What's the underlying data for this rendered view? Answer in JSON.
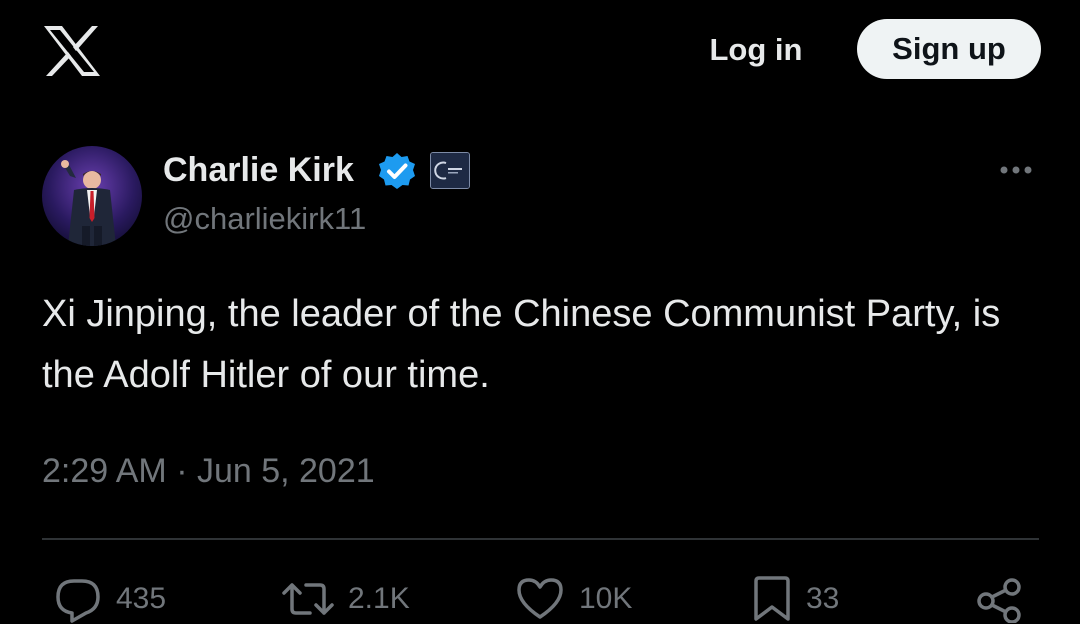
{
  "header": {
    "logo_icon": "x-logo-icon",
    "login_label": "Log in",
    "signup_label": "Sign up"
  },
  "tweet": {
    "author": {
      "name": "Charlie Kirk",
      "handle": "@charliekirk11",
      "verified_icon": "verified-badge-icon",
      "verified_color": "#1d9bf0",
      "affiliate_icon": "affiliate-badge-icon"
    },
    "more_icon": "more-horizontal-icon",
    "text": "Xi Jinping, the leader of the Chinese Communist Party, is the Adolf Hitler of our time.",
    "timestamp": "2:29 AM · Jun 5, 2021",
    "actions": [
      {
        "name": "reply",
        "icon": "reply-icon",
        "count": "435"
      },
      {
        "name": "repost",
        "icon": "repost-icon",
        "count": "2.1K"
      },
      {
        "name": "like",
        "icon": "heart-icon",
        "count": "10K"
      },
      {
        "name": "bookmark",
        "icon": "bookmark-icon",
        "count": "33"
      },
      {
        "name": "share",
        "icon": "share-icon",
        "count": ""
      }
    ]
  },
  "colors": {
    "background": "#000000",
    "primary_text": "#e7e9ea",
    "secondary_text": "#71767b",
    "divider": "#2f3336",
    "signup_bg": "#eff3f4"
  }
}
